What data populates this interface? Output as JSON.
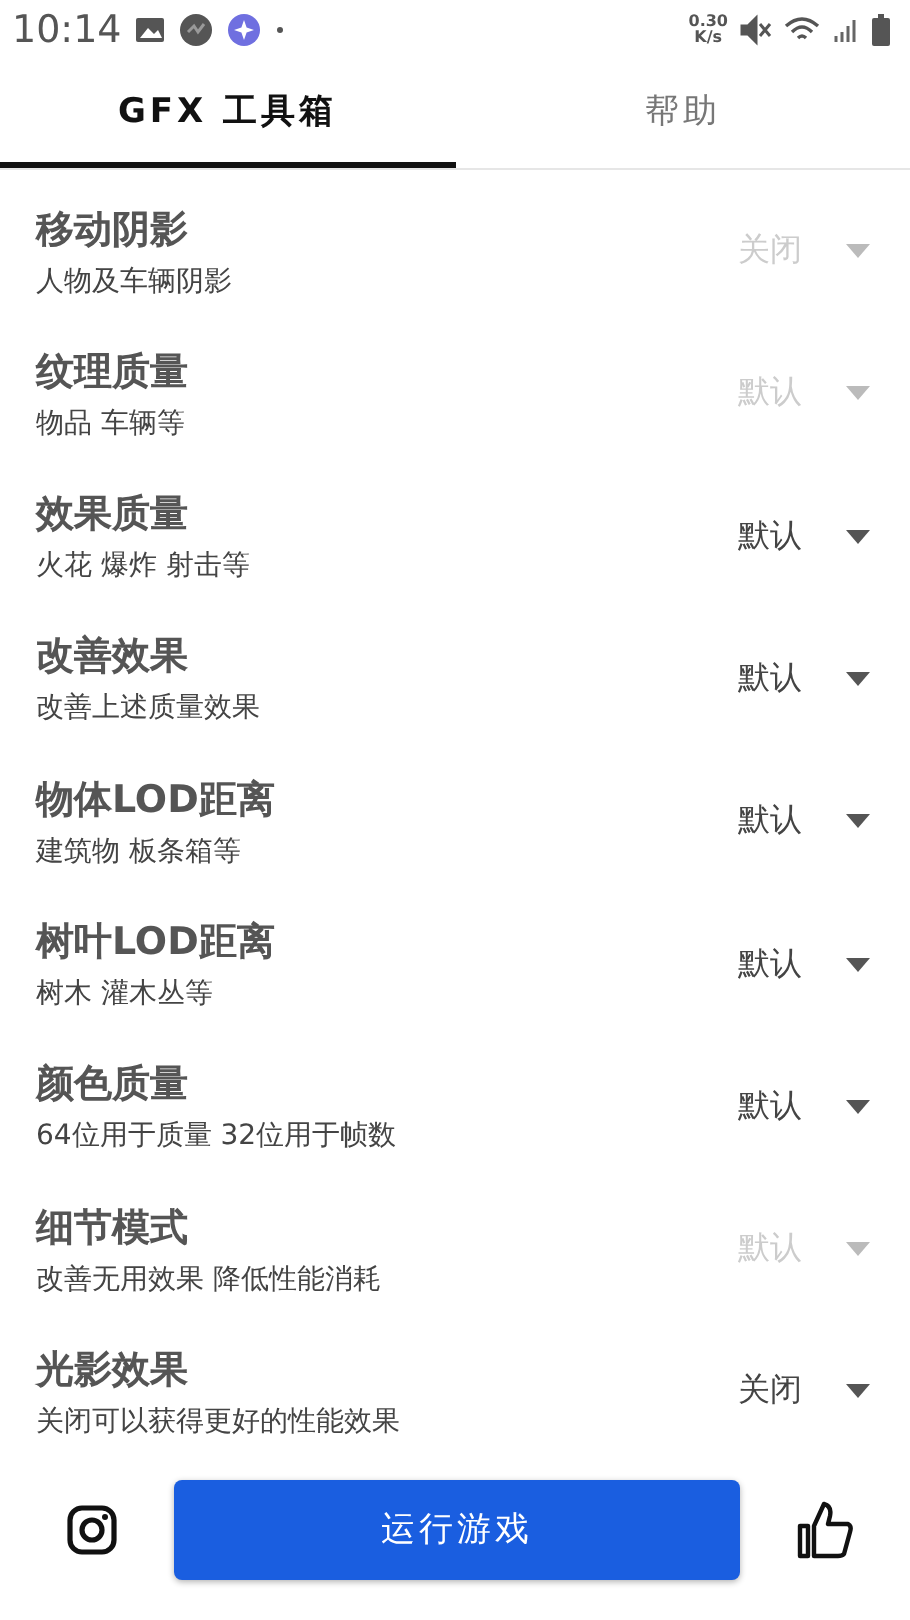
{
  "status_bar": {
    "time": "10:14",
    "net_speed_value": "0.30",
    "net_speed_unit": "K/s"
  },
  "tabs": [
    {
      "label": "GFX 工具箱",
      "selected": true
    },
    {
      "label": "帮助",
      "selected": false
    }
  ],
  "settings": [
    {
      "title": "移动阴影",
      "subtitle": "人物及车辆阴影",
      "value": "关闭",
      "disabled": true
    },
    {
      "title": "纹理质量",
      "subtitle": "物品 车辆等",
      "value": "默认",
      "disabled": true
    },
    {
      "title": "效果质量",
      "subtitle": "火花 爆炸 射击等",
      "value": "默认",
      "disabled": false
    },
    {
      "title": "改善效果",
      "subtitle": "改善上述质量效果",
      "value": "默认",
      "disabled": false
    },
    {
      "title": "物体LOD距离",
      "subtitle": "建筑物 板条箱等",
      "value": "默认",
      "disabled": false
    },
    {
      "title": "树叶LOD距离",
      "subtitle": "树木 灌木丛等",
      "value": "默认",
      "disabled": false
    },
    {
      "title": "颜色质量",
      "subtitle": "64位用于质量 32位用于帧数",
      "value": "默认",
      "disabled": false
    },
    {
      "title": "细节模式",
      "subtitle": "改善无用效果 降低性能消耗",
      "value": "默认",
      "disabled": true
    },
    {
      "title": "光影效果",
      "subtitle": "关闭可以获得更好的性能效果",
      "value": "关闭",
      "disabled": false
    }
  ],
  "run_button": {
    "label": "运行游戏"
  }
}
